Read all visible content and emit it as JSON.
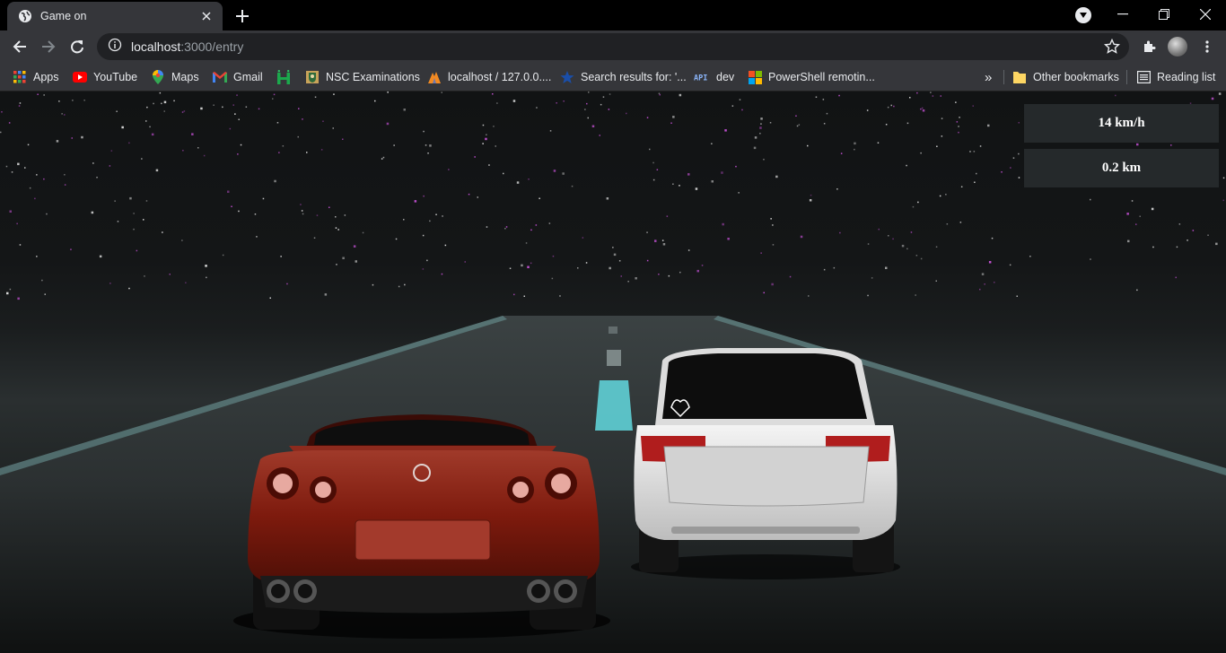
{
  "browser": {
    "tab": {
      "title": "Game on",
      "favicon": "globe-icon"
    },
    "address_bar": {
      "host": "localhost",
      "path": ":3000/entry"
    },
    "bookmarks": [
      {
        "label": "Apps",
        "icon": "apps-grid-icon"
      },
      {
        "label": "YouTube",
        "icon": "youtube-icon"
      },
      {
        "label": "Maps",
        "icon": "maps-pin-icon"
      },
      {
        "label": "Gmail",
        "icon": "gmail-icon"
      },
      {
        "label": "",
        "icon": "hackerrank-icon"
      },
      {
        "label": "NSC Examinations",
        "icon": "crest-icon"
      },
      {
        "label": "localhost / 127.0.0....",
        "icon": "phpmyadmin-icon"
      },
      {
        "label": "Search results for: '...",
        "icon": "star-bookmark-icon"
      },
      {
        "label": "dev",
        "icon": "api-icon"
      },
      {
        "label": "PowerShell remotin...",
        "icon": "microsoft-icon"
      }
    ],
    "overflow_label": "»",
    "other_bookmarks": "Other bookmarks",
    "reading_list": "Reading list"
  },
  "game": {
    "speed": "14 km/h",
    "distance": "0.2 km",
    "player_car_color": "#7d1a0d",
    "opponent_car_color": "#e6e6e6"
  }
}
